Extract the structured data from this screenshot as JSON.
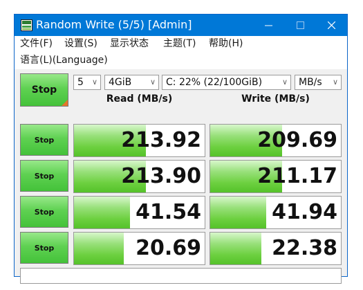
{
  "window": {
    "title": "Random Write (5/5) [Admin]",
    "accent_color": "#0078d7",
    "icon": "app-icon"
  },
  "menu": [
    {
      "label": "文件(F)"
    },
    {
      "label": "设置(S)"
    },
    {
      "label": "显示状态"
    },
    {
      "label": "主题(T)"
    },
    {
      "label": "帮助(H)"
    },
    {
      "label": "语言(L)(Language)"
    }
  ],
  "controls": {
    "stop_all_label": "Stop",
    "count": "5",
    "size": "4GiB",
    "drive": "C: 22% (22/100GiB)",
    "unit": "MB/s"
  },
  "columns": {
    "read": "Read (MB/s)",
    "write": "Write (MB/s)"
  },
  "rows": [
    {
      "stop_label": "Stop",
      "read": "213.92",
      "write": "209.69",
      "read_fill": 0.55,
      "write_fill": 0.55
    },
    {
      "stop_label": "Stop",
      "read": "213.90",
      "write": "211.17",
      "read_fill": 0.55,
      "write_fill": 0.55
    },
    {
      "stop_label": "Stop",
      "read": "41.54",
      "write": "41.94",
      "read_fill": 0.43,
      "write_fill": 0.43
    },
    {
      "stop_label": "Stop",
      "read": "20.69",
      "write": "22.38",
      "read_fill": 0.38,
      "write_fill": 0.39
    }
  ],
  "status": {
    "text": ""
  }
}
